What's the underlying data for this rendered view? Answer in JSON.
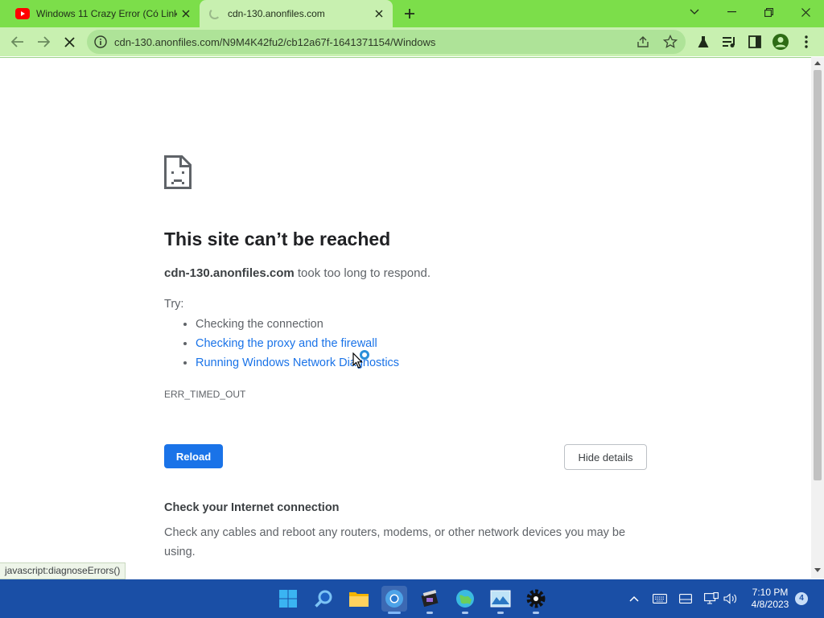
{
  "browser": {
    "tabs": [
      {
        "title": "Windows 11 Crazy Error (Có Link",
        "favicon": "youtube-icon",
        "active": false
      },
      {
        "title": "cdn-130.anonfiles.com",
        "favicon": "loading-spinner",
        "active": true
      }
    ],
    "address_url": "cdn-130.anonfiles.com/N9M4K42fu2/cb12a67f-1641371154/Windows",
    "colors": {
      "tabstrip": "#7cde4a",
      "toolbar": "#c8f0b0",
      "omnibox": "#aee398"
    }
  },
  "error_page": {
    "heading": "This site can’t be reached",
    "host": "cdn-130.anonfiles.com",
    "host_suffix": " took too long to respond.",
    "try_label": "Try:",
    "suggestions": [
      "Checking the connection",
      "Checking the proxy and the firewall",
      "Running Windows Network Diagnostics"
    ],
    "error_code": "ERR_TIMED_OUT",
    "reload_label": "Reload",
    "hide_details_label": "Hide details",
    "details_heading": "Check your Internet connection",
    "details_text": "Check any cables and reboot any routers, modems, or other network devices you may be using.",
    "accent_color": "#1a73e8"
  },
  "status_bar": {
    "text": "javascript:diagnoseErrors()"
  },
  "taskbar": {
    "apps": [
      "start-icon",
      "search-icon",
      "file-explorer-icon",
      "chrome-icon",
      "video-editor-icon",
      "maps-icon",
      "photos-icon",
      "settings-icon"
    ],
    "time": "7:10 PM",
    "date": "4/8/2023",
    "notifications": "4",
    "color": "#1a4fa6"
  }
}
